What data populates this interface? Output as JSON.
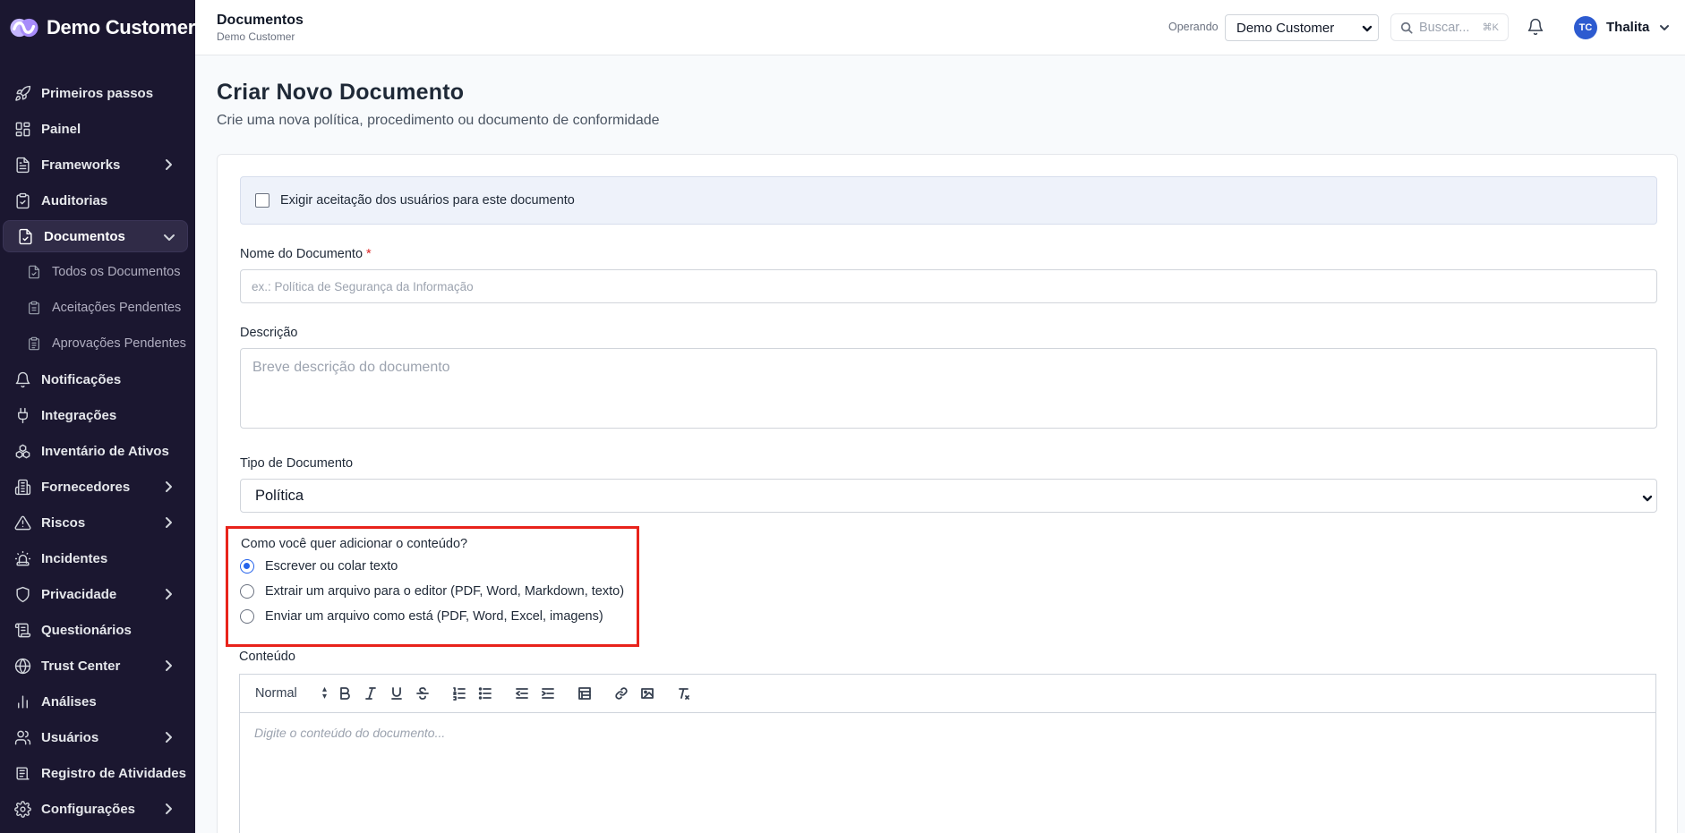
{
  "brand": {
    "name": "Demo Customer"
  },
  "sidebar": {
    "items": [
      {
        "label": "Primeiros passos",
        "icon": "rocket-icon"
      },
      {
        "label": "Painel",
        "icon": "dashboard-icon"
      },
      {
        "label": "Frameworks",
        "icon": "document-icon",
        "expandable": true
      },
      {
        "label": "Auditorias",
        "icon": "clipboard-check-icon"
      },
      {
        "label": "Documentos",
        "icon": "file-check-icon",
        "expandable": true,
        "active": true
      },
      {
        "label": "Notificações",
        "icon": "bell-icon"
      },
      {
        "label": "Integrações",
        "icon": "plug-icon"
      },
      {
        "label": "Inventário de Ativos",
        "icon": "boxes-icon"
      },
      {
        "label": "Fornecedores",
        "icon": "building-icon",
        "expandable": true
      },
      {
        "label": "Riscos",
        "icon": "warning-icon",
        "expandable": true
      },
      {
        "label": "Incidentes",
        "icon": "siren-icon"
      },
      {
        "label": "Privacidade",
        "icon": "shield-icon",
        "expandable": true
      },
      {
        "label": "Questionários",
        "icon": "questionnaire-icon"
      },
      {
        "label": "Trust Center",
        "icon": "globe-icon",
        "expandable": true
      },
      {
        "label": "Análises",
        "icon": "bar-chart-icon"
      },
      {
        "label": "Usuários",
        "icon": "users-icon",
        "expandable": true
      },
      {
        "label": "Registro de Atividades",
        "icon": "activity-log-icon"
      },
      {
        "label": "Configurações",
        "icon": "gear-icon",
        "expandable": true
      }
    ],
    "documentos_sub": [
      {
        "label": "Todos os Documentos"
      },
      {
        "label": "Aceitações Pendentes"
      },
      {
        "label": "Aprovações Pendentes"
      }
    ]
  },
  "header": {
    "title": "Documentos",
    "subtitle": "Demo Customer",
    "operando_label": "Operando",
    "org_selected": "Demo Customer",
    "search_placeholder": "Buscar...",
    "search_shortcut": "⌘K",
    "user_initials": "TC",
    "user_name": "Thalita"
  },
  "main": {
    "title": "Criar Novo Documento",
    "subtitle": "Crie uma nova política, procedimento ou documento de conformidade",
    "accept_label": "Exigir aceitação dos usuários para este documento",
    "name_label": "Nome do Documento",
    "name_required": "*",
    "name_placeholder": "ex.: Política de Segurança da Informação",
    "desc_label": "Descrição",
    "desc_placeholder": "Breve descrição do documento",
    "type_label": "Tipo de Documento",
    "type_selected": "Política",
    "method_question": "Como você quer adicionar o conteúdo?",
    "method_options": [
      {
        "label": "Escrever ou colar texto",
        "selected": true
      },
      {
        "label": "Extrair um arquivo para o editor (PDF, Word, Markdown, texto)",
        "selected": false
      },
      {
        "label": "Enviar um arquivo como está (PDF, Word, Excel, imagens)",
        "selected": false
      }
    ],
    "content_label": "Conteúdo",
    "editor_size": "Normal",
    "editor_placeholder": "Digite o conteúdo do documento..."
  },
  "colors": {
    "sidebar_bg": "#1b1730",
    "accent": "#2563eb",
    "highlight_box": "#e8231b",
    "avatar": "#2d5bd0"
  }
}
